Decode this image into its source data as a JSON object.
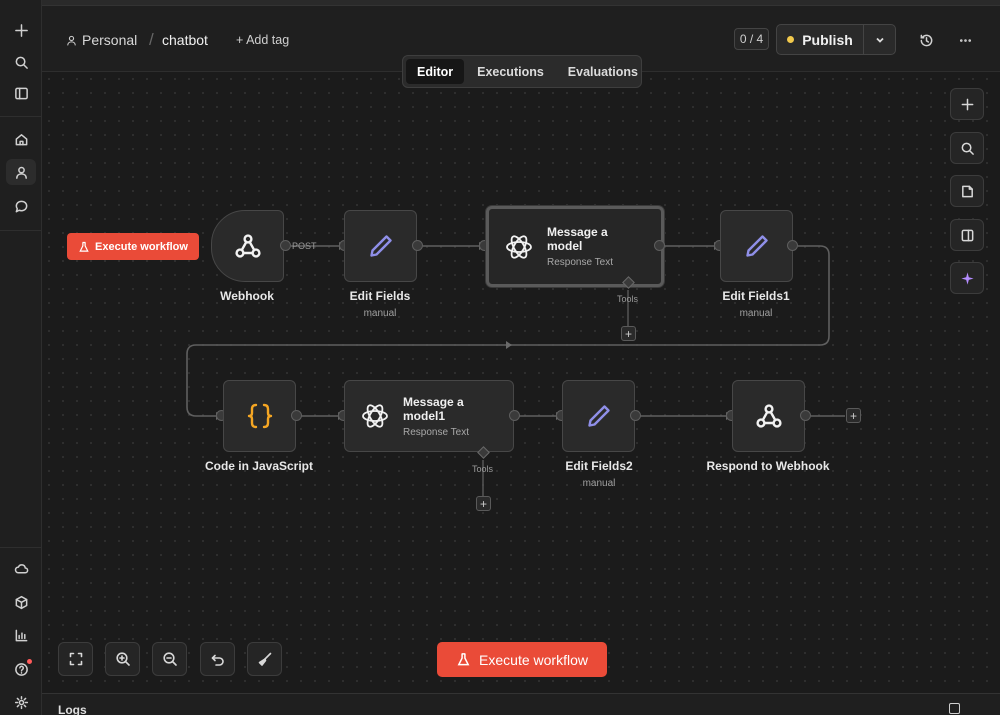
{
  "header": {
    "project": "Personal",
    "workflow_name": "chatbot",
    "add_tag": "+ Add tag",
    "counter": "0 / 4",
    "publish_label": "Publish"
  },
  "tabs": [
    {
      "label": "Editor",
      "active": true
    },
    {
      "label": "Executions",
      "active": false
    },
    {
      "label": "Evaluations",
      "active": false
    }
  ],
  "canvas": {
    "execute_small_label": "Execute workflow",
    "execute_big_label": "Execute workflow",
    "edge_post_label": "POST",
    "tools_label": "Tools",
    "nodes": [
      {
        "id": "webhook",
        "label": "Webhook",
        "icon": "webhook-icon"
      },
      {
        "id": "edit-fields",
        "label": "Edit Fields",
        "sublabel": "manual",
        "icon": "pencil-icon"
      },
      {
        "id": "message-model",
        "title": "Message a model",
        "subtitle": "Response Text",
        "icon": "openai-icon"
      },
      {
        "id": "edit-fields1",
        "label": "Edit Fields1",
        "sublabel": "manual",
        "icon": "pencil-icon"
      },
      {
        "id": "code-js",
        "label": "Code in JavaScript",
        "icon": "braces-icon"
      },
      {
        "id": "message-model1",
        "title": "Message a model1",
        "subtitle": "Response Text",
        "icon": "openai-icon"
      },
      {
        "id": "edit-fields2",
        "label": "Edit Fields2",
        "sublabel": "manual",
        "icon": "pencil-icon"
      },
      {
        "id": "respond-webhook",
        "label": "Respond to Webhook",
        "icon": "webhook-icon"
      }
    ]
  },
  "logs": {
    "label": "Logs"
  },
  "colors": {
    "accent": "#ea4b38",
    "publish_dot": "#f2c94c",
    "pencil": "#8f8fe8",
    "braces": "#f5a623",
    "ai": "#b48cff"
  }
}
